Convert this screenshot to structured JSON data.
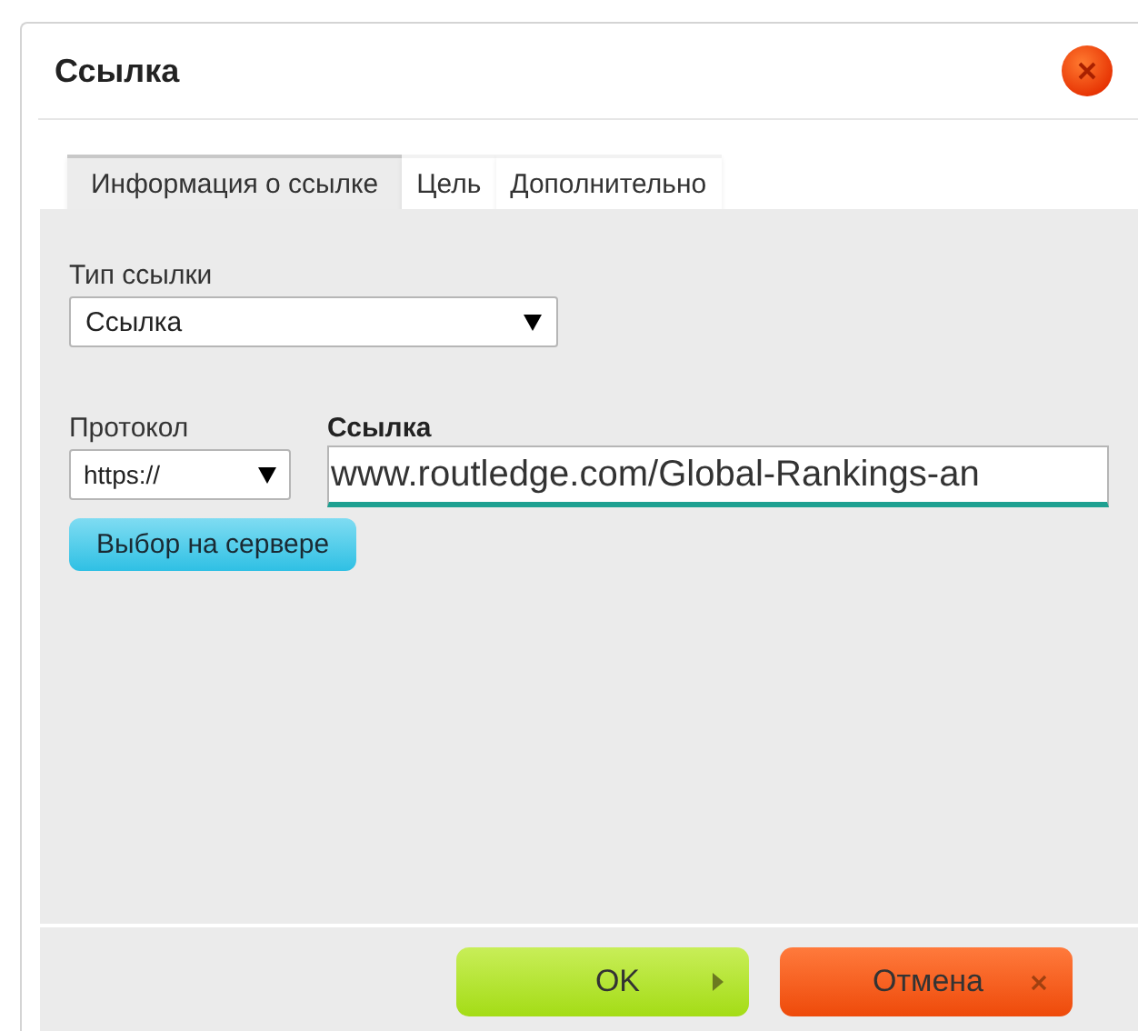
{
  "dialog": {
    "title": "Ссылка"
  },
  "tabs": [
    {
      "label": "Информация о ссылке",
      "selected": true
    },
    {
      "label": "Цель",
      "selected": false
    },
    {
      "label": "Дополнительно",
      "selected": false
    }
  ],
  "link_type": {
    "label": "Тип ссылки",
    "value": "Ссылка"
  },
  "protocol": {
    "label": "Протокол",
    "value": "https://"
  },
  "url": {
    "label": "Ссылка",
    "value": "www.routledge.com/Global-Rankings-an"
  },
  "browse_button": "Выбор на сервере",
  "buttons": [
    {
      "kind": "ok",
      "label": "OK"
    },
    {
      "kind": "cancel",
      "label": "Отмена"
    }
  ]
}
